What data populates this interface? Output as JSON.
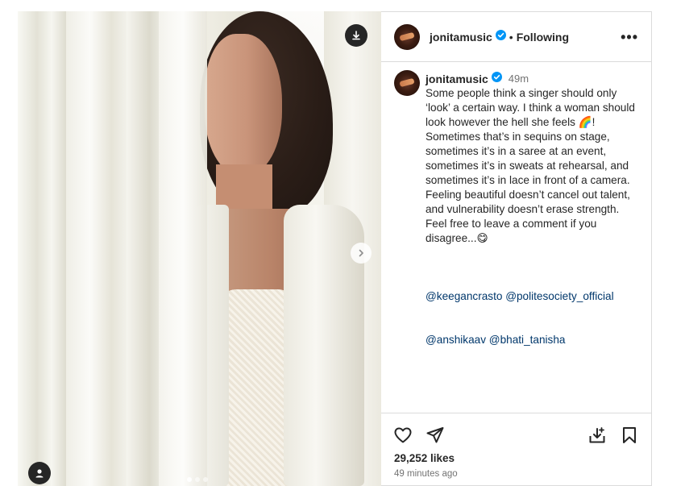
{
  "post": {
    "username": "jonitamusic",
    "follow_status": "Following",
    "separator": "•",
    "more_menu": "•••",
    "caption_time": "49m",
    "caption_text": "Some people think a singer should only ‘look’ a certain way. I think a woman should look however the hell she feels 🌈! Sometimes that’s in sequins on stage, sometimes it’s in a saree at an event, sometimes it’s in sweats at rehearsal, and sometimes it’s in lace in front of a camera. Feeling beautiful doesn’t cancel out talent, and vulnerability doesn’t erase strength. Feel free to leave a comment if you disagree...😋",
    "mentions_line1": "@keegancrasto @politesociety_official",
    "mentions_line2": "@anshikaav @bhati_tanisha",
    "likes": "29,252 likes",
    "posted_ago": "49 minutes ago"
  },
  "carousel": {
    "slide_count": 3,
    "active_slide": 1
  },
  "icons": {
    "download": "download-icon",
    "next": "chevron-right-icon",
    "tag": "user-tag-icon",
    "verified": "verified-badge-icon",
    "like": "heart-icon",
    "share": "send-icon",
    "save_to": "save-to-collection-icon",
    "bookmark": "bookmark-icon"
  },
  "colors": {
    "verified_blue": "#0095f6",
    "mention_link": "#00376b",
    "muted_text": "#737373",
    "border": "#dbdbdb"
  }
}
